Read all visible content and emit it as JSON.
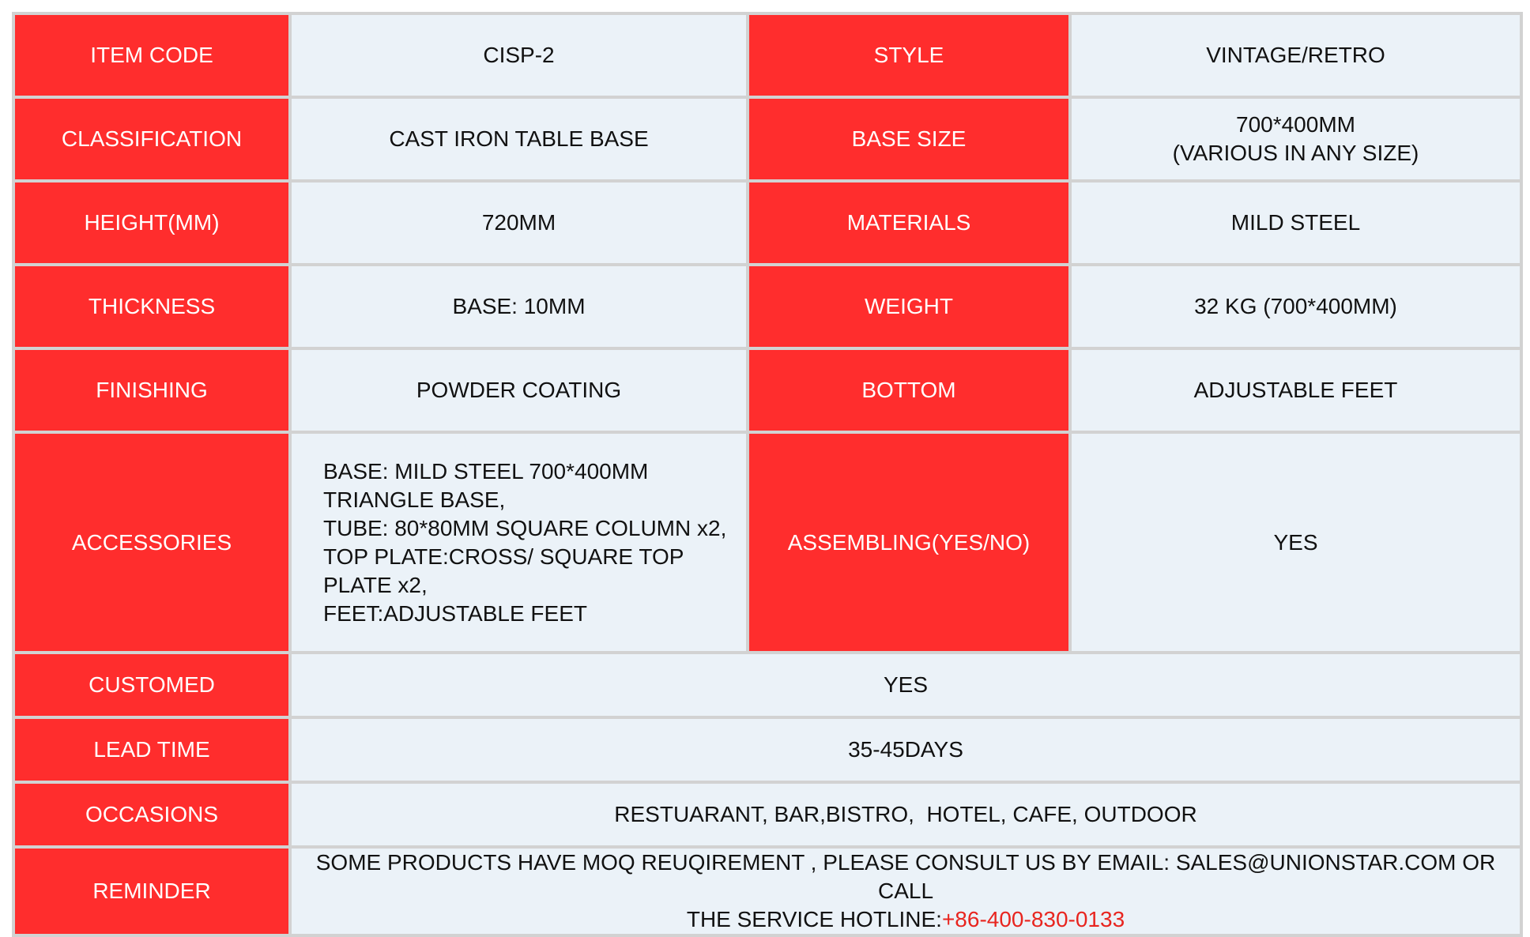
{
  "rows": [
    {
      "l1": "ITEM CODE",
      "v1": "CISP-2",
      "l2": "STYLE",
      "v2": "VINTAGE/RETRO"
    },
    {
      "l1": "CLASSIFICATION",
      "v1": "CAST IRON TABLE BASE",
      "l2": "BASE SIZE",
      "v2a": "700*400MM",
      "v2b": "(VARIOUS IN ANY SIZE)"
    },
    {
      "l1": "HEIGHT(MM)",
      "v1": "720MM",
      "l2": "MATERIALS",
      "v2": "MILD STEEL"
    },
    {
      "l1": "THICKNESS",
      "v1": "BASE: 10MM",
      "l2": "WEIGHT",
      "v2": "32 KG (700*400MM)"
    },
    {
      "l1": "FINISHING",
      "v1": "POWDER COATING",
      "l2": "BOTTOM",
      "v2": "ADJUSTABLE FEET"
    },
    {
      "l1": "ACCESSORIES",
      "v1_lines": [
        "BASE: MILD STEEL 700*400MM",
        "TRIANGLE BASE,",
        "TUBE: 80*80MM SQUARE COLUMN x2,",
        "TOP PLATE:CROSS/ SQUARE TOP",
        "PLATE x2,",
        "FEET:ADJUSTABLE FEET"
      ],
      "l2": "ASSEMBLING(YES/NO)",
      "v2": "YES"
    }
  ],
  "wide_rows": [
    {
      "label": "CUSTOMED",
      "value": "YES"
    },
    {
      "label": "LEAD TIME",
      "value": "35-45DAYS"
    },
    {
      "label": "OCCASIONS",
      "value": "RESTUARANT, BAR,BISTRO,  HOTEL, CAFE, OUTDOOR"
    }
  ],
  "reminder": {
    "label": "REMINDER",
    "line1": "SOME PRODUCTS HAVE MOQ REUQIREMENT , PLEASE CONSULT US BY EMAIL: SALES@UNIONSTAR.COM OR CALL",
    "line2_prefix": "THE SERVICE HOTLINE:",
    "hotline": "+86-400-830-0133"
  },
  "colors": {
    "label_bg": "#ff2d2d",
    "value_bg": "#ebf2f8",
    "grid": "#d2d2d2",
    "hotline": "#e8251f"
  }
}
